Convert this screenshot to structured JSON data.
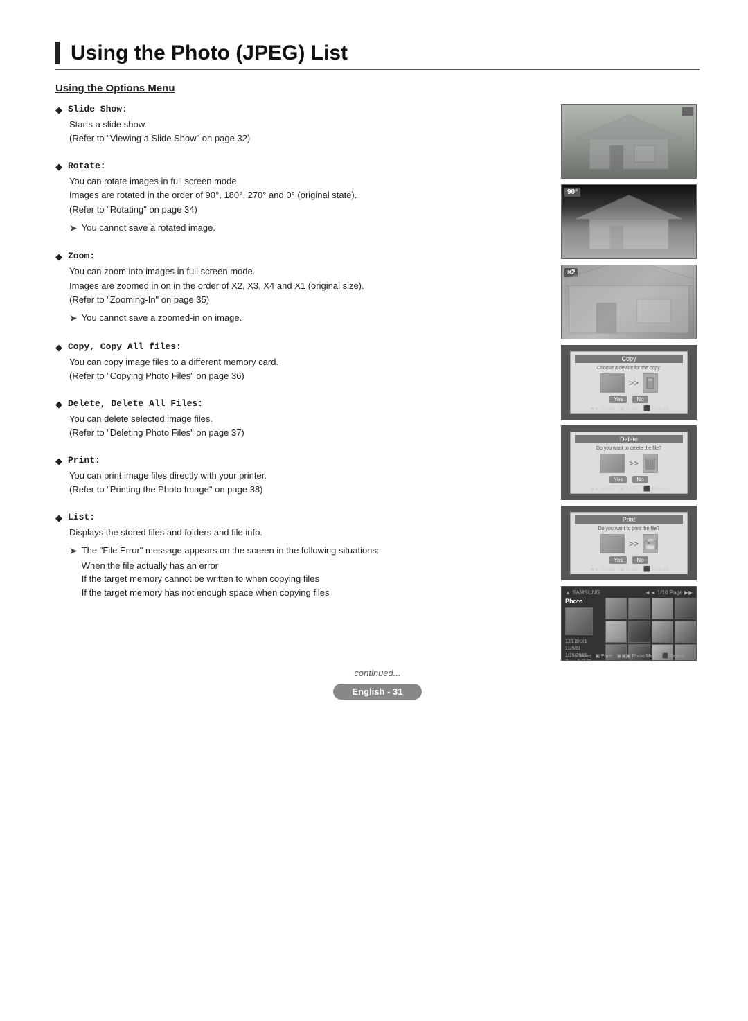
{
  "page": {
    "title": "Using the Photo (JPEG) List",
    "section_title": "Using the Options Menu",
    "continued_text": "continued...",
    "page_number": "English - 31",
    "language_label": "English"
  },
  "options": [
    {
      "id": "slide-show",
      "title": "Slide Show:",
      "lines": [
        "Starts a slide show.",
        "(Refer to \"Viewing a Slide Show\" on page 32)"
      ],
      "notes": [],
      "image_type": "house_normal"
    },
    {
      "id": "rotate",
      "title": "Rotate:",
      "lines": [
        "You can rotate images in full screen mode.",
        "Images are rotated in the order of 90°, 180°, 270° and 0° (original state).",
        "(Refer to \"Rotating\" on page 34)"
      ],
      "notes": [
        "You cannot save a rotated image."
      ],
      "image_type": "house_rotated",
      "badge": "90°"
    },
    {
      "id": "zoom",
      "title": "Zoom:",
      "lines": [
        "You can zoom into images in full screen mode.",
        "Images are zoomed in on in the order of X2, X3, X4 and X1 (original size).",
        "(Refer to \"Zooming-In\" on page 35)"
      ],
      "notes": [
        "You cannot save a zoomed-in on image."
      ],
      "image_type": "house_zoomed",
      "badge": "×2"
    },
    {
      "id": "copy",
      "title": "Copy, Copy All files:",
      "lines": [
        "You can copy image files to a different memory card.",
        "(Refer to \"Copying Photo Files\" on page 36)"
      ],
      "notes": [],
      "image_type": "dialog_copy",
      "dialog_title": "Copy",
      "dialog_subtitle": "Choose a device for the copy.",
      "dialog_btn1": "Yes",
      "dialog_btn2": "No"
    },
    {
      "id": "delete",
      "title": "Delete, Delete All Files:",
      "lines": [
        "You can delete selected image files.",
        "(Refer to \"Deleting Photo Files\" on page 37)"
      ],
      "notes": [],
      "image_type": "dialog_delete",
      "dialog_title": "Delete",
      "dialog_subtitle": "Do you want to delete the file?",
      "dialog_btn1": "Yes",
      "dialog_btn2": "No"
    },
    {
      "id": "print",
      "title": "Print:",
      "lines": [
        "You can print image files directly with your printer.",
        "(Refer to \"Printing the Photo Image\" on page 38)"
      ],
      "notes": [],
      "image_type": "dialog_print",
      "dialog_title": "Print",
      "dialog_subtitle": "Do you want to print the file?",
      "dialog_btn1": "Yes",
      "dialog_btn2": "No"
    },
    {
      "id": "list",
      "title": "List:",
      "lines": [
        "Displays the stored files and folders and file info."
      ],
      "notes": [],
      "image_type": "list_screen",
      "sub_notes": [
        "The \"File Error\" message appears on the screen in the following situations:",
        "When the file actually has an error",
        "If the target memory cannot be written to when copying files",
        "If the target memory has not enough space when copying files"
      ]
    }
  ]
}
